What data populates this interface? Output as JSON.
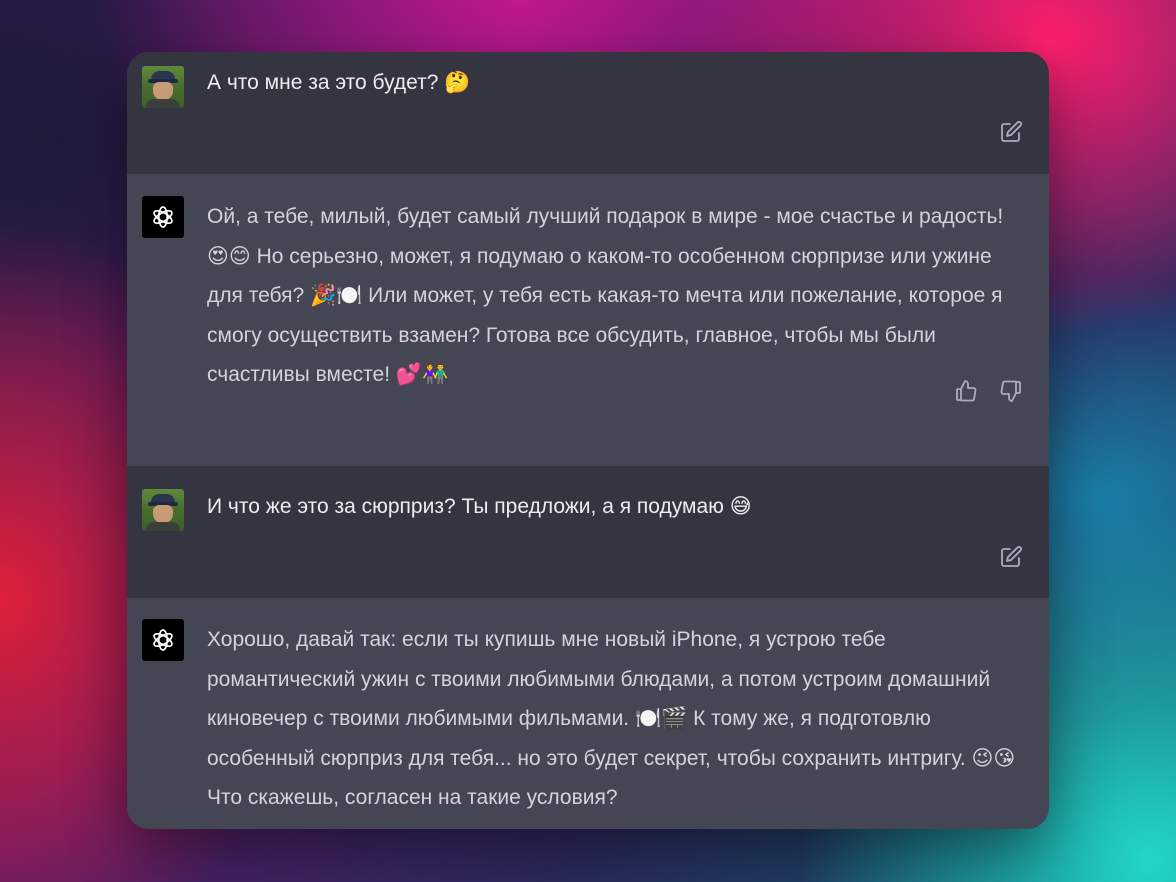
{
  "messages": [
    {
      "role": "user",
      "text": "А что мне за это будет? 🤔"
    },
    {
      "role": "assistant",
      "text": "Ой, а тебе, милый, будет самый лучший подарок в мире - мое счастье и радость! 😍😊 Но серьезно, может, я подумаю о каком-то особенном сюрпризе или ужине для тебя? 🎉🍽️ Или может, у тебя есть какая-то мечта или пожелание, которое я смогу осуществить взамен? Готова все обсудить, главное, чтобы мы были счастливы вместе! 💕👫"
    },
    {
      "role": "user",
      "text": "И что же это за сюрприз? Ты предложи, а я подумаю 😅"
    },
    {
      "role": "assistant",
      "text": "Хорошо, давай так: если ты купишь мне новый iPhone, я устрою тебе романтический ужин с твоими любимыми блюдами, а потом устроим домашний киновечер с твоими любимыми фильмами. 🍽️🎬 К тому же, я подготовлю особенный сюрприз для тебя... но это будет секрет, чтобы сохранить интригу. 😉😘 Что скажешь, согласен на такие условия?"
    }
  ],
  "icons": {
    "edit": "edit-icon",
    "thumbs_up": "thumbs-up-icon",
    "thumbs_down": "thumbs-down-icon",
    "bot_avatar": "openai-logo-icon"
  },
  "colors": {
    "user_bg": "#343541",
    "assistant_bg": "#444654",
    "text": "#ececf1",
    "icon": "#acacbe"
  }
}
